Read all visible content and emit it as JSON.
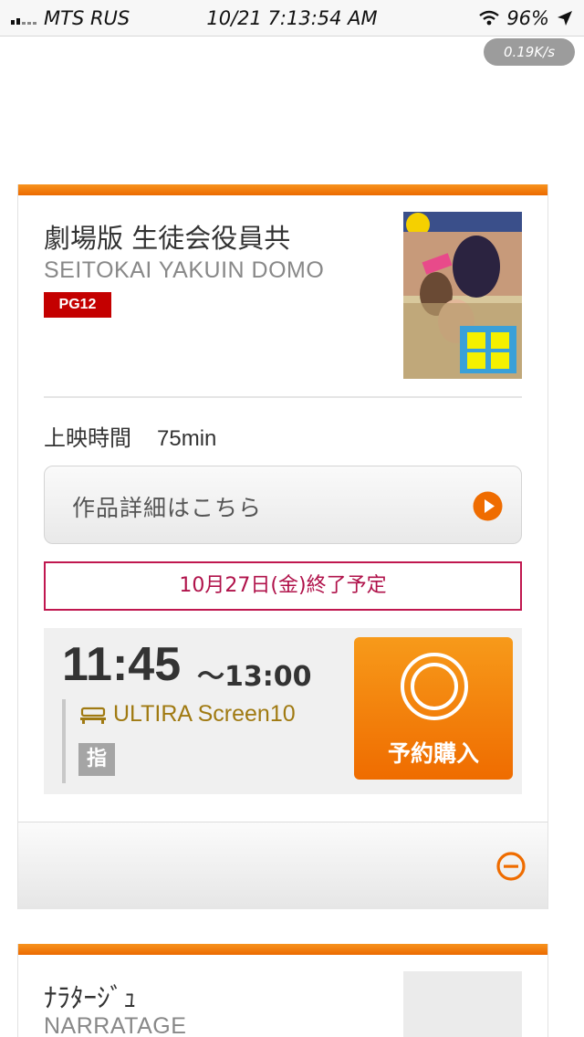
{
  "status_bar": {
    "carrier": "MTS RUS",
    "datetime": "10/21 7:13:54 AM",
    "battery": "96%",
    "net_speed": "0.19K/s"
  },
  "movie": {
    "title_jp": "劇場版 生徒会役員共",
    "title_en": "SEITOKAI YAKUIN DOMO",
    "rating": "PG12",
    "runtime_label": "上映時間",
    "runtime_value": "75min",
    "detail_button": "作品詳細はこちら",
    "end_notice": "10月27日(金)終了予定",
    "showtime": {
      "start": "11:45",
      "end": "～13:00",
      "screen": "ULTIRA Screen10",
      "seat_badge": "指",
      "book_label": "予約購入"
    }
  },
  "movie2": {
    "title_jp": "ﾅﾗﾀｰｼﾞｭ",
    "title_en": "NARRATAGE"
  },
  "colors": {
    "accent_orange": "#ef6c00",
    "notice_red": "#c0174f",
    "rating_red": "#c40000",
    "screen_gold": "#a07a12"
  }
}
